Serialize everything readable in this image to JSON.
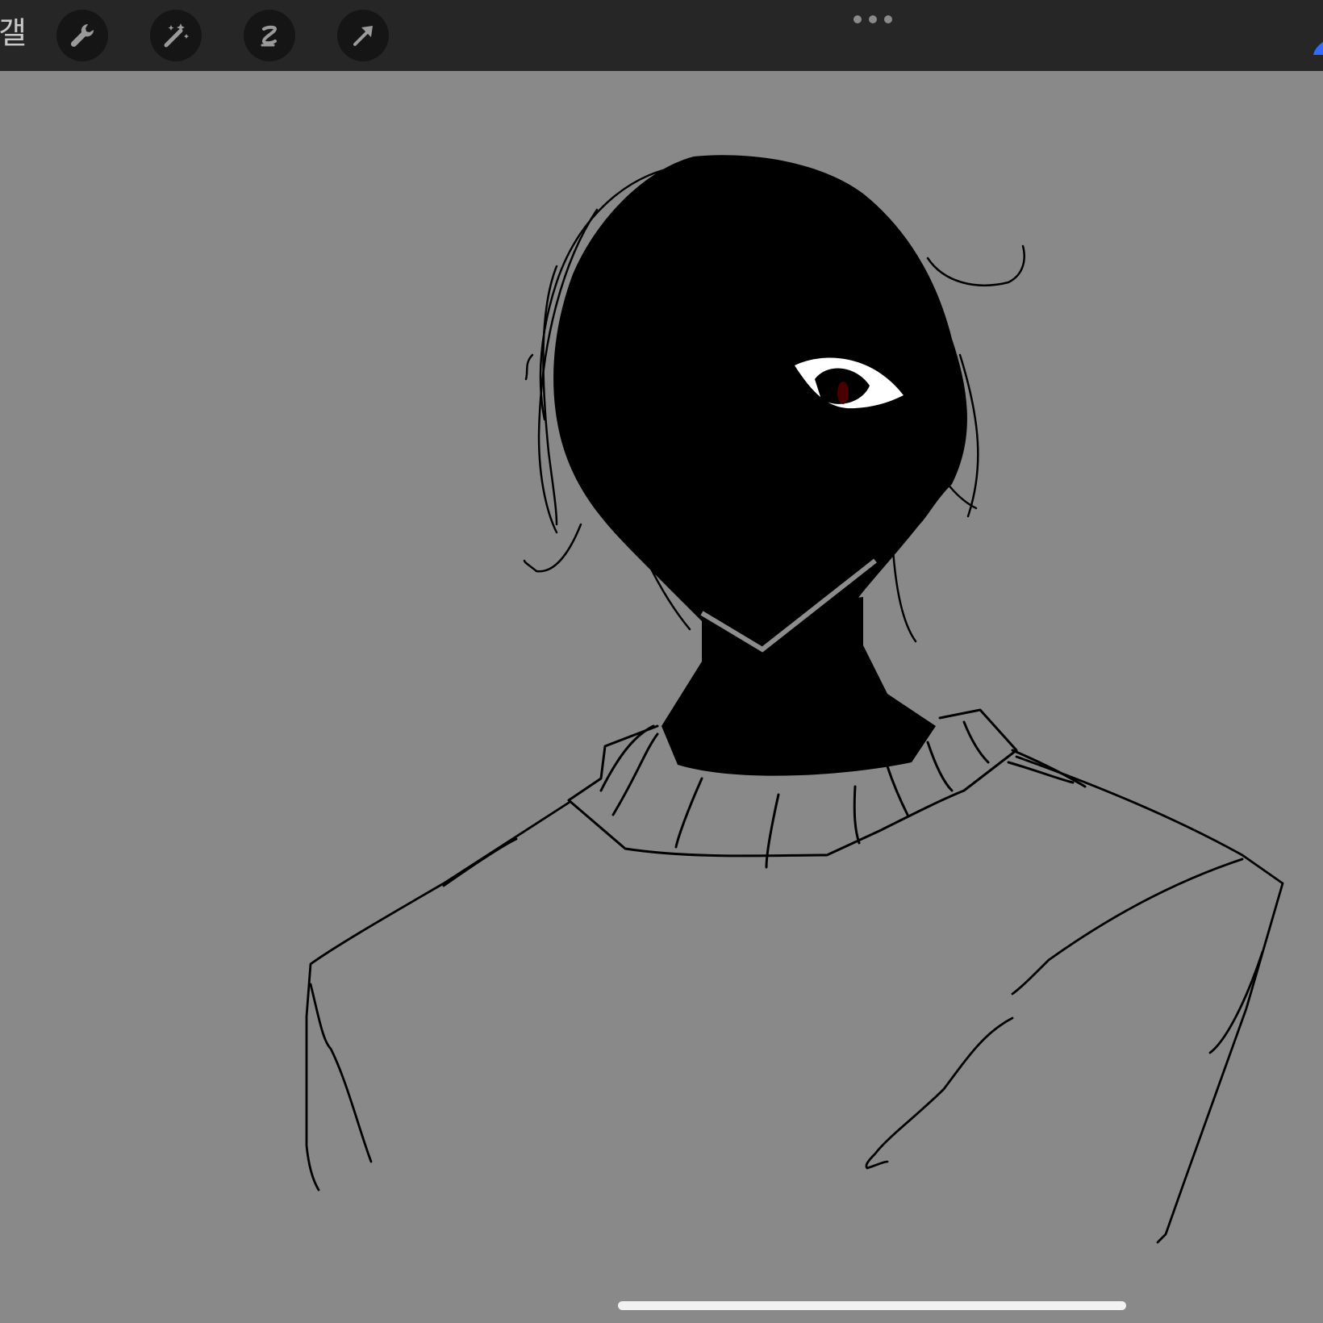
{
  "toolbar": {
    "gallery_label": "갤러리",
    "tools": [
      {
        "name": "actions",
        "icon": "wrench-icon"
      },
      {
        "name": "adjustments",
        "icon": "magic-wand-icon"
      },
      {
        "name": "selection",
        "icon": "selection-s-icon"
      },
      {
        "name": "transform",
        "icon": "arrow-cursor-icon"
      }
    ],
    "more_icon": "ellipsis-icon",
    "accent_color": "#2f6bff"
  },
  "canvas": {
    "background_color": "#898989",
    "ink_color": "#000000",
    "eye_iris_color": "#4a0000",
    "subject": "sketch-illustration"
  },
  "colors": {
    "toolbar_bg": "#262626",
    "button_bg": "#151515",
    "icon_color": "#9a9a9a"
  }
}
